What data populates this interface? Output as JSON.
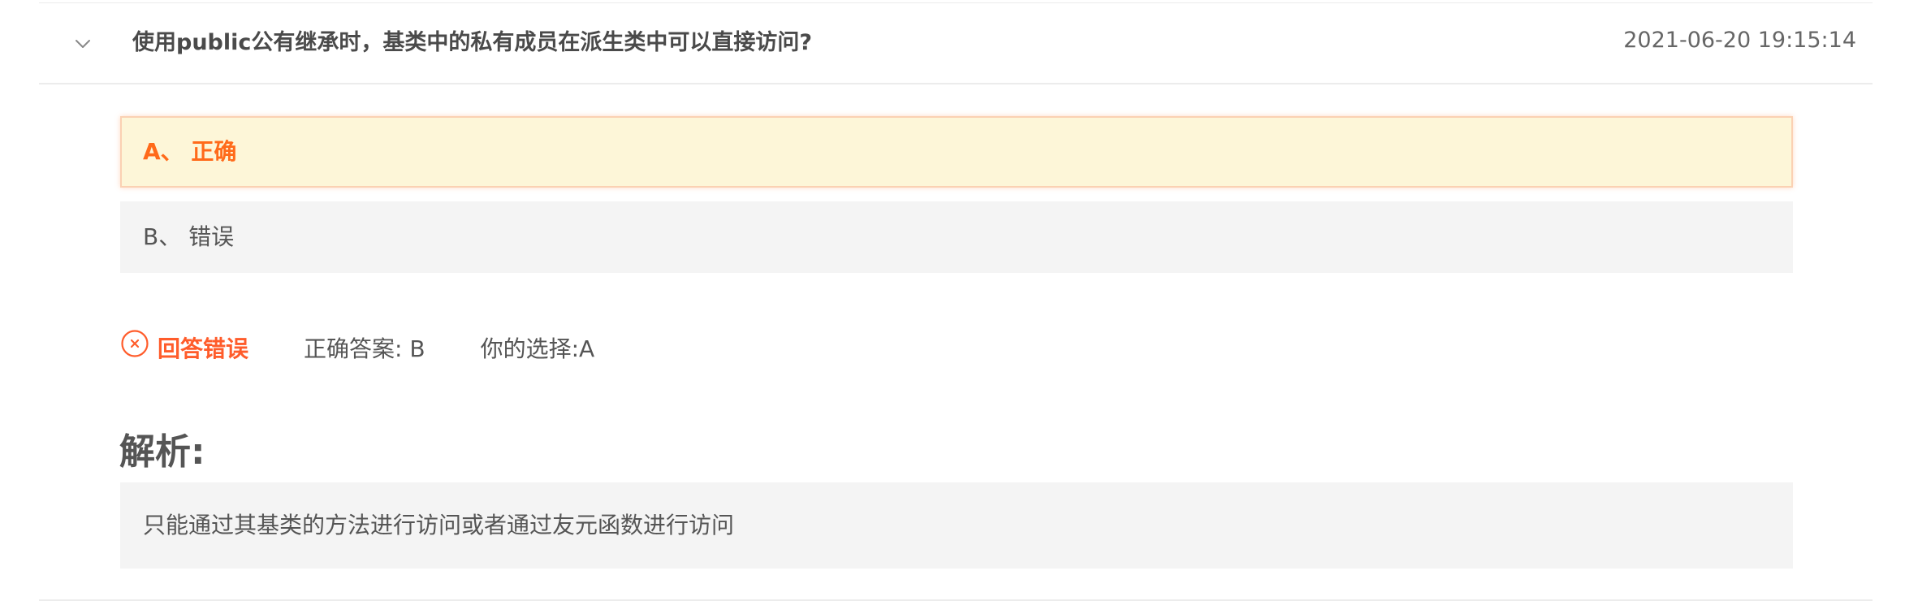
{
  "question": {
    "expand_icon": "chevron-down-icon",
    "text": "使用public公有继承时，基类中的私有成员在派生类中可以直接访问?",
    "timestamp": "2021-06-20 19:15:14"
  },
  "options": [
    {
      "label": "A、 正确",
      "selected": true
    },
    {
      "label": "B、 错误",
      "selected": false
    }
  ],
  "result": {
    "icon": "x-circle-icon",
    "status": "回答错误",
    "correct_answer": "正确答案: B",
    "your_choice": "你的选择:A"
  },
  "analysis": {
    "title": "解析:",
    "text": "只能通过其基类的方法进行访问或者通过友元函数进行访问"
  },
  "colors": {
    "selected_bg": "#fdf6d8",
    "selected_border": "#fbd1b3",
    "selected_text": "#ff6a1a",
    "wrong_status": "#ff5c2b",
    "panel_bg": "#f4f4f4",
    "divider": "#ececec"
  }
}
